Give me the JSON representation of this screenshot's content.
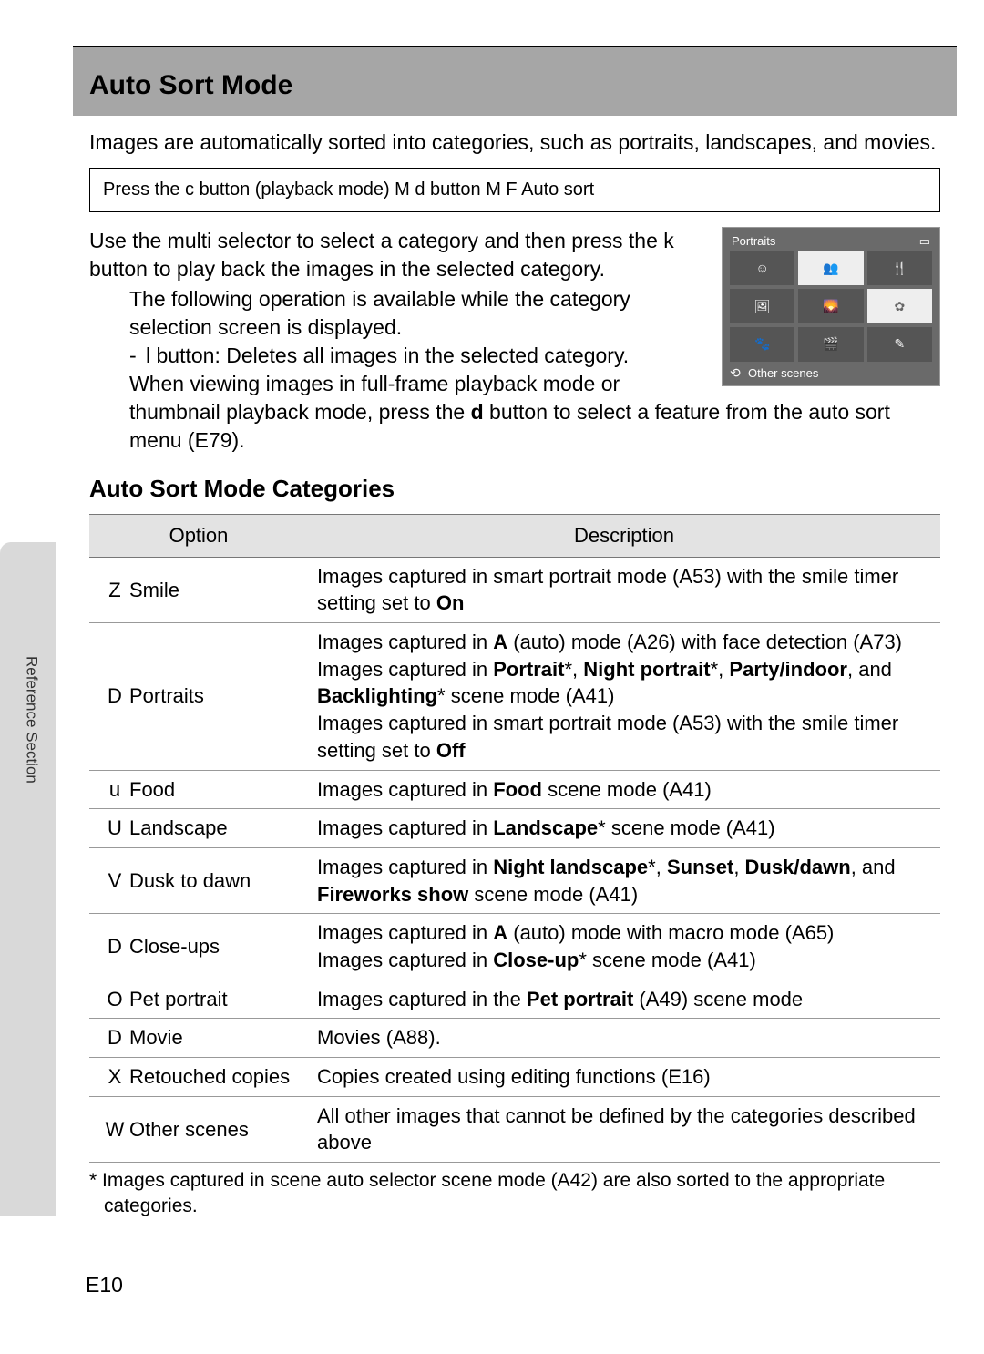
{
  "page_number_prefix": "E",
  "page_number": "10",
  "side_label": "Reference Section",
  "title": "Auto Sort Mode",
  "intro": "Images are automatically sorted into categories, such as portraits, landscapes, and movies.",
  "nav_path": "Press the c button (playback mode) M d button M F Auto sort",
  "body": {
    "p1": "Use the multi selector to select a category and then press the k button to play back the images in the selected category.",
    "bullet1": "The following operation is available while the category selection screen is displayed.",
    "bullet1a": "l button: Deletes all images in the selected category.",
    "bullet2_a": "When viewing images in full-frame playback mode or thumbnail playback mode, press the ",
    "bullet2_b": "d",
    "bullet2_c": " button to select a feature from the auto sort menu (E79)."
  },
  "preview": {
    "header": "Portraits",
    "battery": "▭",
    "footer_icon": "⟲",
    "footer": "Other scenes",
    "cells": [
      {
        "t": "icon",
        "v": "☺"
      },
      {
        "t": "thumb",
        "v": "👥"
      },
      {
        "t": "icon",
        "v": "🍴"
      },
      {
        "t": "icon",
        "v": "🖼"
      },
      {
        "t": "icon",
        "v": "🌄"
      },
      {
        "t": "thumb",
        "v": "✿"
      },
      {
        "t": "icon",
        "v": "🐾"
      },
      {
        "t": "icon",
        "v": "🎬"
      },
      {
        "t": "icon",
        "v": "✎"
      }
    ]
  },
  "subhead": "Auto Sort Mode Categories",
  "table": {
    "head_option": "Option",
    "head_description": "Description",
    "rows": [
      {
        "icon": "Z",
        "option": "Smile",
        "desc": "Images captured in smart portrait mode (A53) with the smile timer setting set to <b>On</b>"
      },
      {
        "icon": "D",
        "option": "Portraits",
        "desc": "Images captured in <b>A</b> (auto) mode (A26) with face detection (A73)<br>Images captured in <b>Portrait</b>*, <b>Night portrait</b>*, <b>Party/indoor</b>, and <b>Backlighting</b>* scene mode (A41)<br>Images captured in smart portrait mode (A53) with the smile timer setting set to <b>Off</b>"
      },
      {
        "icon": "u",
        "option": "Food",
        "desc": "Images captured in <b>Food</b> scene mode (A41)"
      },
      {
        "icon": "U",
        "option": "Landscape",
        "desc": "Images captured in <b>Landscape</b>* scene mode (A41)"
      },
      {
        "icon": "V",
        "option": "Dusk to dawn",
        "desc": "Images captured in <b>Night landscape</b>*, <b>Sunset</b>, <b>Dusk/dawn</b>, and <b>Fireworks show</b> scene mode (A41)"
      },
      {
        "icon": "D",
        "option": "Close-ups",
        "desc": "Images captured in <b>A</b> (auto) mode with macro mode (A65)<br>Images captured in <b>Close-up</b>* scene mode (A41)"
      },
      {
        "icon": "O",
        "option": "Pet portrait",
        "desc": "Images captured in the <b>Pet portrait</b> (A49) scene mode"
      },
      {
        "icon": "D",
        "option": "Movie",
        "desc": "Movies (A88)."
      },
      {
        "icon": "X",
        "option": "Retouched copies",
        "desc": "Copies created using editing functions (E16)"
      },
      {
        "icon": "W",
        "option": "Other scenes",
        "desc": "All other images that cannot be defined by the categories described above"
      }
    ]
  },
  "footnote": "*  Images captured in scene auto selector scene mode (A42) are also sorted to the appropriate categories."
}
